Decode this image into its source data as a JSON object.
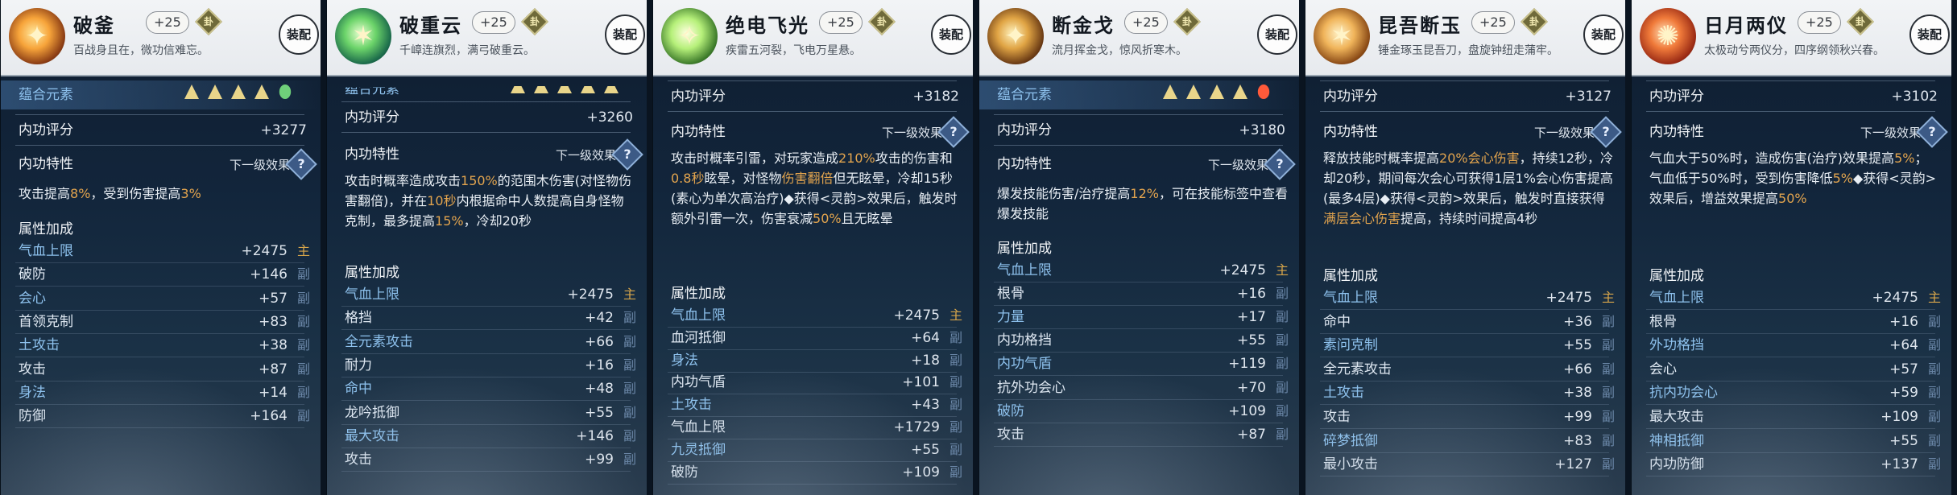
{
  "equip_label": "装配",
  "labels": {
    "yuansu": "蕴合元素",
    "score": "内功评分",
    "trait": "内功特性",
    "next_effect": "下一级效果",
    "attr_bonus": "属性加成",
    "question": "?",
    "gem_glyph": "卦",
    "tag_main": "主",
    "tag_sub": "副"
  },
  "panels": [
    {
      "name": "破釜",
      "level": "+25",
      "motto": "百战身且在，微功信难忘。",
      "icon": "fire-axe-icon",
      "score": "+3277",
      "gems": [
        "rune",
        "rune",
        "rune",
        "rune",
        "leaf"
      ],
      "desc": [
        {
          "t": "攻击提高"
        },
        {
          "t": "8%",
          "hl": true
        },
        {
          "t": "，受到伤害提高"
        },
        {
          "t": "3%",
          "hl": true
        }
      ],
      "attrs": [
        {
          "label": "气血上限",
          "value": "+2475",
          "tag": "主"
        },
        {
          "label": "破防",
          "value": "+146",
          "tag": "副"
        },
        {
          "label": "会心",
          "value": "+57",
          "tag": "副"
        },
        {
          "label": "首领克制",
          "value": "+83",
          "tag": "副"
        },
        {
          "label": "土攻击",
          "value": "+38",
          "tag": "副"
        },
        {
          "label": "攻击",
          "value": "+87",
          "tag": "副"
        },
        {
          "label": "身法",
          "value": "+14",
          "tag": "副"
        },
        {
          "label": "防御",
          "value": "+164",
          "tag": "副"
        }
      ]
    },
    {
      "name": "破重云",
      "level": "+25",
      "motto": "千嶂连旗烈，满弓破重云。",
      "icon": "jade-bow-icon",
      "score": "+3260",
      "desc": [
        {
          "t": "攻击时概率造成攻击"
        },
        {
          "t": "150%",
          "hl": true
        },
        {
          "t": "的范围木伤害(对怪物伤害翻倍)，并在"
        },
        {
          "t": "10秒",
          "hl": true
        },
        {
          "t": "内根据命中人数提高自身怪物克制，最多提高"
        },
        {
          "t": "15%",
          "hl": true
        },
        {
          "t": "，冷却20秒"
        }
      ],
      "attrs": [
        {
          "label": "气血上限",
          "value": "+2475",
          "tag": "主"
        },
        {
          "label": "格挡",
          "value": "+42",
          "tag": "副"
        },
        {
          "label": "全元素攻击",
          "value": "+66",
          "tag": "副"
        },
        {
          "label": "耐力",
          "value": "+16",
          "tag": "副"
        },
        {
          "label": "命中",
          "value": "+48",
          "tag": "副"
        },
        {
          "label": "龙吟抵御",
          "value": "+55",
          "tag": "副"
        },
        {
          "label": "最大攻击",
          "value": "+146",
          "tag": "副"
        },
        {
          "label": "攻击",
          "value": "+99",
          "tag": "副"
        }
      ]
    },
    {
      "name": "绝电飞光",
      "level": "+25",
      "motto": "疾雷五河裂，飞电万星悬。",
      "icon": "lightning-spear-icon",
      "score": "+3182",
      "desc": [
        {
          "t": "攻击时概率引雷，对玩家造成"
        },
        {
          "t": "210%",
          "hl": true
        },
        {
          "t": "攻击的伤害和"
        },
        {
          "t": "0.8秒",
          "hl": true
        },
        {
          "t": "眩晕，对怪物"
        },
        {
          "t": "伤害翻倍",
          "hl": true
        },
        {
          "t": "但无眩晕，冷却15秒(素心为单次高治疗)◆获得<灵韵>效果后，触发时额外引雷一次，伤害衰减"
        },
        {
          "t": "50%",
          "hl": true
        },
        {
          "t": "且无眩晕"
        }
      ],
      "attrs": [
        {
          "label": "气血上限",
          "value": "+2475",
          "tag": "主"
        },
        {
          "label": "血河抵御",
          "value": "+64",
          "tag": "副"
        },
        {
          "label": "身法",
          "value": "+18",
          "tag": "副"
        },
        {
          "label": "内功气盾",
          "value": "+101",
          "tag": "副"
        },
        {
          "label": "土攻击",
          "value": "+43",
          "tag": "副"
        },
        {
          "label": "气血上限",
          "value": "+1729",
          "tag": "副"
        },
        {
          "label": "九灵抵御",
          "value": "+55",
          "tag": "副"
        },
        {
          "label": "破防",
          "value": "+109",
          "tag": "副"
        }
      ]
    },
    {
      "name": "断金戈",
      "level": "+25",
      "motto": "流月挥金戈，惊风折寒木。",
      "icon": "golden-halberd-icon",
      "score": "+3180",
      "gems": [
        "rune",
        "rune",
        "rune",
        "rune",
        "flame"
      ],
      "desc": [
        {
          "t": "爆发技能伤害/治疗提高"
        },
        {
          "t": "12%",
          "hl": true
        },
        {
          "t": "，可在技能标签中查看爆发技能"
        }
      ],
      "attrs": [
        {
          "label": "气血上限",
          "value": "+2475",
          "tag": "主"
        },
        {
          "label": "根骨",
          "value": "+16",
          "tag": "副"
        },
        {
          "label": "力量",
          "value": "+17",
          "tag": "副"
        },
        {
          "label": "内功格挡",
          "value": "+55",
          "tag": "副"
        },
        {
          "label": "内功气盾",
          "value": "+119",
          "tag": "副"
        },
        {
          "label": "抗外功会心",
          "value": "+70",
          "tag": "副"
        },
        {
          "label": "破防",
          "value": "+109",
          "tag": "副"
        },
        {
          "label": "攻击",
          "value": "+87",
          "tag": "副"
        }
      ]
    },
    {
      "name": "昆吾断玉",
      "level": "+25",
      "motto": "锤金琢玉昆吾刀，盘旋钟纽走蒲牢。",
      "icon": "jade-saber-icon",
      "score": "+3127",
      "desc": [
        {
          "t": "释放技能时概率提高"
        },
        {
          "t": "20%会心伤害",
          "hl": true
        },
        {
          "t": "，持续12秒，冷却20秒，期间每次会心可获得1层1%会心伤害提高(最多4层)◆获得<灵韵>效果后，触发时直接获得"
        },
        {
          "t": "满层会心伤害",
          "hl": true
        },
        {
          "t": "提高，持续时间提高4秒"
        }
      ],
      "attrs": [
        {
          "label": "气血上限",
          "value": "+2475",
          "tag": "主"
        },
        {
          "label": "命中",
          "value": "+36",
          "tag": "副"
        },
        {
          "label": "素问克制",
          "value": "+55",
          "tag": "副"
        },
        {
          "label": "全元素攻击",
          "value": "+66",
          "tag": "副"
        },
        {
          "label": "土攻击",
          "value": "+38",
          "tag": "副"
        },
        {
          "label": "攻击",
          "value": "+99",
          "tag": "副"
        },
        {
          "label": "碎梦抵御",
          "value": "+83",
          "tag": "副"
        },
        {
          "label": "最小攻击",
          "value": "+127",
          "tag": "副"
        }
      ]
    },
    {
      "name": "日月两仪",
      "level": "+25",
      "motto": "太极动兮两仪分，四序纲领秋兴春。",
      "icon": "sun-moon-icon",
      "score": "+3102",
      "desc": [
        {
          "t": "气血大于50%时，造成伤害(治疗)效果提高"
        },
        {
          "t": "5%",
          "hl": true
        },
        {
          "t": "；气血低于50%时，受到伤害降低"
        },
        {
          "t": "5%",
          "hl": true
        },
        {
          "t": "◆获得<灵韵>效果后，增益效果提高"
        },
        {
          "t": "50%",
          "hl": true
        }
      ],
      "attrs": [
        {
          "label": "气血上限",
          "value": "+2475",
          "tag": "主"
        },
        {
          "label": "根骨",
          "value": "+16",
          "tag": "副"
        },
        {
          "label": "外功格挡",
          "value": "+64",
          "tag": "副"
        },
        {
          "label": "会心",
          "value": "+57",
          "tag": "副"
        },
        {
          "label": "抗内功会心",
          "value": "+59",
          "tag": "副"
        },
        {
          "label": "最大攻击",
          "value": "+109",
          "tag": "副"
        },
        {
          "label": "神相抵御",
          "value": "+55",
          "tag": "副"
        },
        {
          "label": "内功防御",
          "value": "+137",
          "tag": "副"
        }
      ]
    }
  ]
}
